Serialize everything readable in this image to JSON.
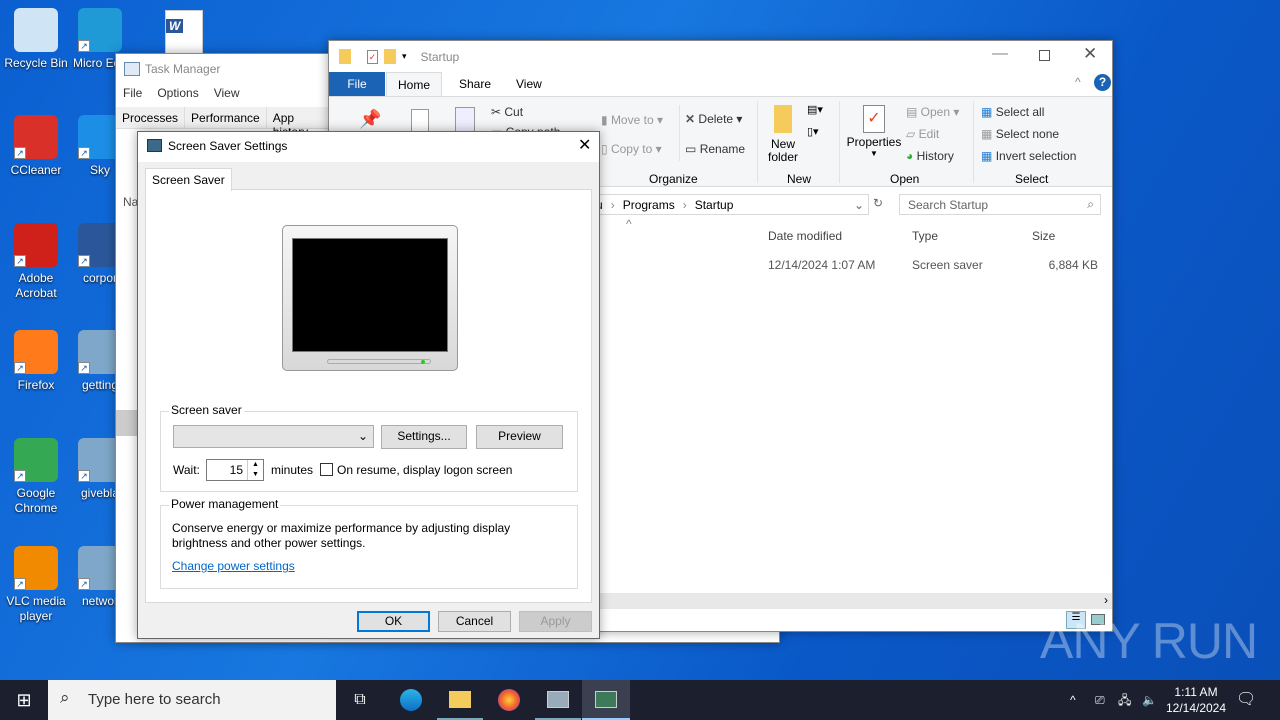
{
  "desktop": {
    "icons": [
      {
        "label": "Recycle Bin",
        "icon": "recycle-bin-icon",
        "color": "#cfe4f5"
      },
      {
        "label": "CCleaner",
        "icon": "ccleaner-icon",
        "color": "#d9302a"
      },
      {
        "label": "Adobe Acrobat",
        "icon": "acrobat-icon",
        "color": "#d0201a"
      },
      {
        "label": "Firefox",
        "icon": "firefox-icon",
        "color": "#ff7a1a"
      },
      {
        "label": "Google Chrome",
        "icon": "chrome-icon",
        "color": "#34a853"
      },
      {
        "label": "VLC media player",
        "icon": "vlc-icon",
        "color": "#f18a00"
      },
      {
        "label": "Micro Edg",
        "icon": "edge-icon",
        "color": "#1f9ad6"
      },
      {
        "label": "Sky",
        "icon": "skype-icon",
        "color": "#1d8ee6"
      },
      {
        "label": "corpor",
        "icon": "word-doc-icon",
        "color": "#2b579a"
      },
      {
        "label": "getting",
        "icon": "image-file-icon",
        "color": "#7fa7c9"
      },
      {
        "label": "givebla",
        "icon": "image-file-icon",
        "color": "#7fa7c9"
      },
      {
        "label": "networ",
        "icon": "image-file-icon",
        "color": "#7fa7c9"
      }
    ]
  },
  "task_manager": {
    "title": "Task Manager",
    "menu": [
      "File",
      "Options",
      "View"
    ],
    "tabs": [
      "Processes",
      "Performance",
      "App history"
    ],
    "col": "Na"
  },
  "explorer": {
    "title": "Startup",
    "tabs": [
      "File",
      "Home",
      "Share",
      "View"
    ],
    "ribbon": {
      "cut": "Cut",
      "copy_path": "Copy path",
      "move_to": "Move to",
      "copy_to": "Copy to",
      "delete": "Delete",
      "rename": "Rename",
      "new_folder_1": "New",
      "new_folder_2": "folder",
      "properties": "Properties",
      "open": "Open",
      "edit": "Edit",
      "history": "History",
      "select_all": "Select all",
      "select_none": "Select none",
      "invert_selection": "Invert selection",
      "groups": [
        "Organize",
        "New",
        "Open",
        "Select"
      ]
    },
    "breadcrumb": [
      "u",
      "Programs",
      "Startup"
    ],
    "search_placeholder": "Search Startup",
    "columns": [
      "Date modified",
      "Type",
      "Size"
    ],
    "rows": [
      {
        "date": "12/14/2024 1:07 AM",
        "type": "Screen saver",
        "size": "6,884 KB"
      }
    ]
  },
  "dialog": {
    "title": "Screen Saver Settings",
    "tab": "Screen Saver",
    "screen_saver_group": "Screen saver",
    "dropdown_value": "",
    "settings_btn": "Settings...",
    "preview_btn": "Preview",
    "wait_label": "Wait:",
    "wait_value": "15",
    "minutes": "minutes",
    "resume_label": "On resume, display logon screen",
    "resume_checked": false,
    "power_group": "Power management",
    "power_text": "Conserve energy or maximize performance by adjusting display brightness and other power settings.",
    "power_link": "Change power settings",
    "ok": "OK",
    "cancel": "Cancel",
    "apply": "Apply"
  },
  "taskbar": {
    "search_placeholder": "Type here to search",
    "time": "1:11 AM",
    "date": "12/14/2024"
  },
  "watermark": "ANY RUN"
}
